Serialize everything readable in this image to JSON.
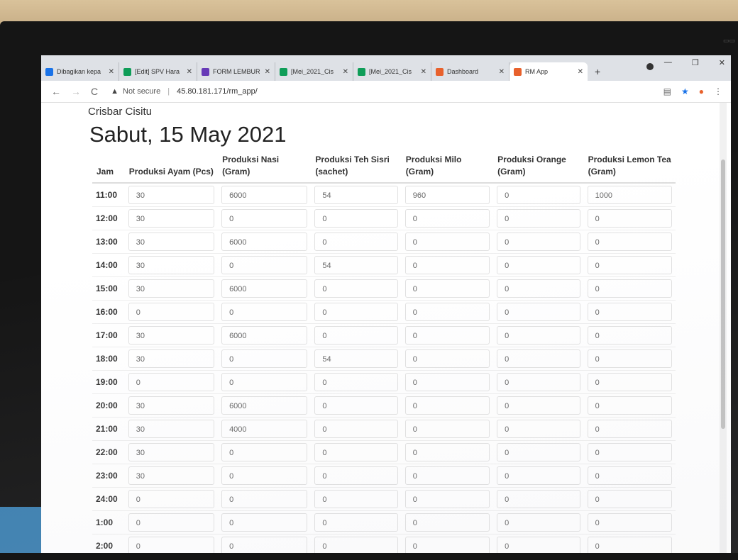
{
  "browser": {
    "tabs": [
      {
        "label": "Dibagikan kepa",
        "icon_color": "#1a73e8"
      },
      {
        "label": "[Edit] SPV Hara",
        "icon_color": "#0f9d58"
      },
      {
        "label": "FORM LEMBUR",
        "icon_color": "#673ab7"
      },
      {
        "label": "[Mei_2021_Cis",
        "icon_color": "#0f9d58"
      },
      {
        "label": "[Mei_2021_Cis",
        "icon_color": "#0f9d58"
      },
      {
        "label": "Dashboard",
        "icon_color": "#e8612c"
      },
      {
        "label": "RM App",
        "icon_color": "#e8612c"
      }
    ],
    "new_tab": "+",
    "address": {
      "security": "Not secure",
      "url": "45.80.181.171/rm_app/"
    }
  },
  "page": {
    "brand": "Crisbar Cisitu",
    "title": "Sabut, 15 May 2021"
  },
  "table": {
    "headers": {
      "jam": "Jam",
      "ayam": "Produksi Ayam (Pcs)",
      "nasi": "Produksi Nasi (Gram)",
      "teh_1": "Produksi Teh Sisri",
      "teh_2": "(sachet)",
      "milo": "Produksi Milo (Gram)",
      "orange_1": "Produksi Orange",
      "orange_2": "(Gram)",
      "lemon_1": "Produksi Lemon Tea",
      "lemon_2": "(Gram)"
    },
    "rows": [
      {
        "time": "11:00",
        "ayam": "30",
        "nasi": "6000",
        "teh": "54",
        "milo": "960",
        "orange": "0",
        "lemon": "1000"
      },
      {
        "time": "12:00",
        "ayam": "30",
        "nasi": "0",
        "teh": "0",
        "milo": "0",
        "orange": "0",
        "lemon": "0"
      },
      {
        "time": "13:00",
        "ayam": "30",
        "nasi": "6000",
        "teh": "0",
        "milo": "0",
        "orange": "0",
        "lemon": "0"
      },
      {
        "time": "14:00",
        "ayam": "30",
        "nasi": "0",
        "teh": "54",
        "milo": "0",
        "orange": "0",
        "lemon": "0"
      },
      {
        "time": "15:00",
        "ayam": "30",
        "nasi": "6000",
        "teh": "0",
        "milo": "0",
        "orange": "0",
        "lemon": "0"
      },
      {
        "time": "16:00",
        "ayam": "0",
        "nasi": "0",
        "teh": "0",
        "milo": "0",
        "orange": "0",
        "lemon": "0"
      },
      {
        "time": "17:00",
        "ayam": "30",
        "nasi": "6000",
        "teh": "0",
        "milo": "0",
        "orange": "0",
        "lemon": "0"
      },
      {
        "time": "18:00",
        "ayam": "30",
        "nasi": "0",
        "teh": "54",
        "milo": "0",
        "orange": "0",
        "lemon": "0"
      },
      {
        "time": "19:00",
        "ayam": "0",
        "nasi": "0",
        "teh": "0",
        "milo": "0",
        "orange": "0",
        "lemon": "0"
      },
      {
        "time": "20:00",
        "ayam": "30",
        "nasi": "6000",
        "teh": "0",
        "milo": "0",
        "orange": "0",
        "lemon": "0"
      },
      {
        "time": "21:00",
        "ayam": "30",
        "nasi": "4000",
        "teh": "0",
        "milo": "0",
        "orange": "0",
        "lemon": "0"
      },
      {
        "time": "22:00",
        "ayam": "30",
        "nasi": "0",
        "teh": "0",
        "milo": "0",
        "orange": "0",
        "lemon": "0"
      },
      {
        "time": "23:00",
        "ayam": "30",
        "nasi": "0",
        "teh": "0",
        "milo": "0",
        "orange": "0",
        "lemon": "0"
      },
      {
        "time": "24:00",
        "ayam": "0",
        "nasi": "0",
        "teh": "0",
        "milo": "0",
        "orange": "0",
        "lemon": "0"
      },
      {
        "time": "1:00",
        "ayam": "0",
        "nasi": "0",
        "teh": "0",
        "milo": "0",
        "orange": "0",
        "lemon": "0"
      },
      {
        "time": "2:00",
        "ayam": "0",
        "nasi": "0",
        "teh": "0",
        "milo": "0",
        "orange": "0",
        "lemon": "0"
      }
    ]
  }
}
